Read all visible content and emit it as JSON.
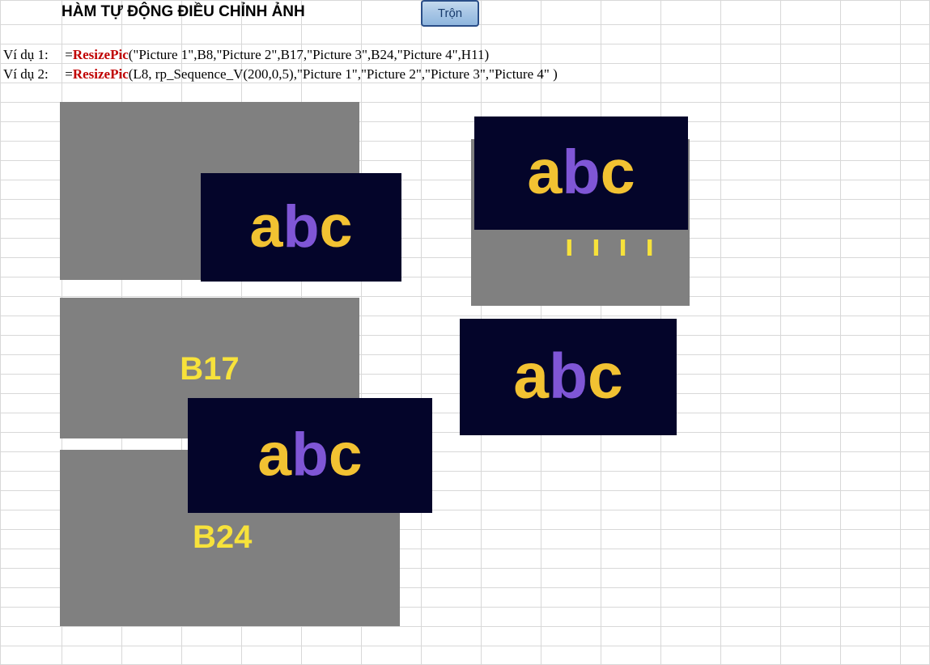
{
  "title": "HÀM TỰ ĐỘNG ĐIỀU CHỈNH ẢNH",
  "button": {
    "label": "Trộn"
  },
  "examples": {
    "row1_label": "Ví dụ 1:",
    "row2_label": "Ví dụ 2:",
    "eq": "=",
    "fn": "ResizePic",
    "args1": "(\"Picture 1\",B8,\"Picture 2\",B17,\"Picture 3\",B24,\"Picture 4\",H11)",
    "args2": "(L8, rp_Sequence_V(200,0,5),\"Picture 1\",\"Picture 2\",\"Picture 3\",\"Picture 4\" )"
  },
  "placeholders": {
    "b17_label": "B17",
    "b24_label": "B24",
    "h11_partial": "ı ı ı ı"
  },
  "colors": {
    "gray": "#808080",
    "yellow": "#f7e23b",
    "navy": "#04052a",
    "purple": "#7f56d6",
    "btn_border": "#2a4e88"
  },
  "abc_text": "abc"
}
